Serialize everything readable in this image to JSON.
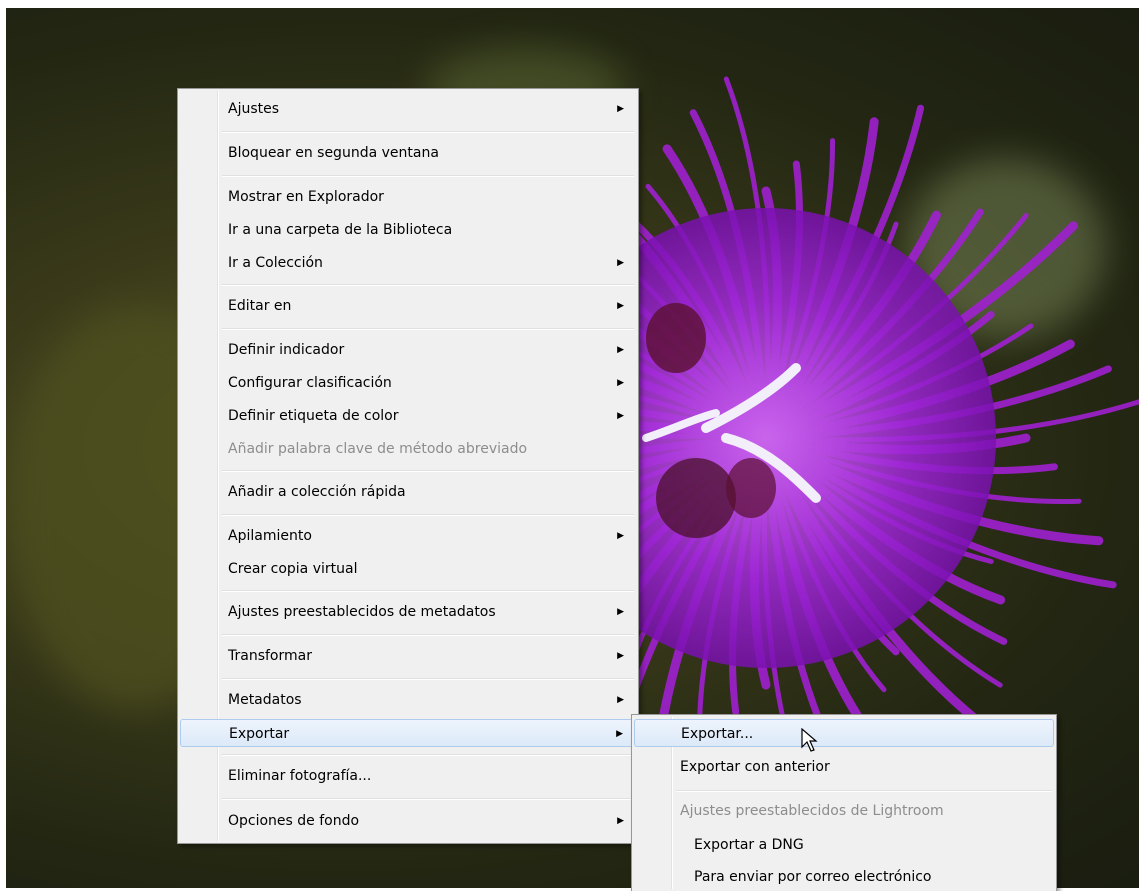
{
  "context_menu": {
    "items": [
      {
        "label": "Ajustes",
        "submenu": true
      },
      {
        "label": "Bloquear en segunda ventana",
        "submenu": false
      },
      {
        "label": "Mostrar en Explorador",
        "submenu": false
      },
      {
        "label": "Ir a una carpeta de la Biblioteca",
        "submenu": false
      },
      {
        "label": "Ir a Colección",
        "submenu": true
      },
      {
        "label": "Editar en",
        "submenu": true
      },
      {
        "label": "Definir indicador",
        "submenu": true
      },
      {
        "label": "Configurar clasificación",
        "submenu": true
      },
      {
        "label": "Definir etiqueta de color",
        "submenu": true
      },
      {
        "label": "Añadir palabra clave de método abreviado",
        "submenu": false,
        "disabled": true
      },
      {
        "label": "Añadir a colección rápida",
        "submenu": false
      },
      {
        "label": "Apilamiento",
        "submenu": true
      },
      {
        "label": "Crear copia virtual",
        "submenu": false
      },
      {
        "label": "Ajustes preestablecidos de metadatos",
        "submenu": true
      },
      {
        "label": "Transformar",
        "submenu": true
      },
      {
        "label": "Metadatos",
        "submenu": true
      },
      {
        "label": "Exportar",
        "submenu": true,
        "highlighted": true
      },
      {
        "label": "Eliminar fotografía...",
        "submenu": false
      },
      {
        "label": "Opciones de fondo",
        "submenu": true
      }
    ],
    "arrow_glyph": "▶"
  },
  "export_submenu": {
    "items": [
      {
        "label": "Exportar...",
        "highlighted": true
      },
      {
        "label": "Exportar con anterior"
      },
      {
        "label": "Ajustes preestablecidos de Lightroom",
        "disabled": true
      },
      {
        "label": "Exportar a DNG"
      },
      {
        "label": "Para enviar por correo electrónico"
      }
    ]
  },
  "colors": {
    "menu_bg": "#f0f0f0",
    "highlight_border": "#aecbef",
    "disabled_text": "#8d8d8d",
    "flower": "#a020d0"
  }
}
